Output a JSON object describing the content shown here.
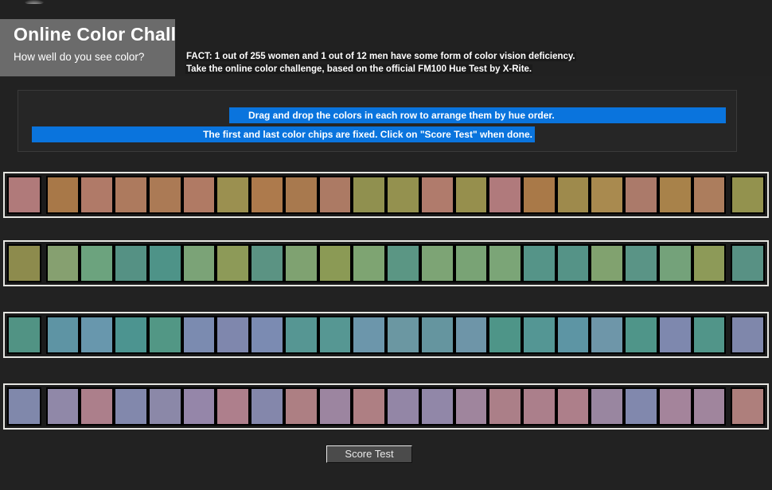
{
  "page": {
    "background": "#222222"
  },
  "header": {
    "title": "Online Color Challenge",
    "subtitle": "How well do you see color?",
    "fact_line_1": "FACT: 1 out of 255 women and 1 out of 12 men have some form of color vision deficiency.",
    "fact_line_2": "Take the online color challenge, based on the official FM100 Hue Test by X-Rite.",
    "left_bg": "#6b6b6b",
    "right_bg": "#212121"
  },
  "instructions": {
    "line_1": "Drag and drop the colors in each row to arrange them by hue order.",
    "line_2": "The first and last color chips are fixed. Click on \"Score Test\" when done.",
    "highlight_color": "#0a74dd"
  },
  "footer": {
    "score_button_label": "Score Test"
  },
  "rows": [
    {
      "index": 1,
      "fixed_first": "#b07a7a",
      "fixed_last": "#93924e",
      "chips": [
        "#a87848",
        "#b07a68",
        "#ad7a5e",
        "#ab7a55",
        "#b07a64",
        "#9b9050",
        "#ad7a4c",
        "#a8794e",
        "#ac7a64",
        "#90904f",
        "#94914f",
        "#b07b6c",
        "#968f4d",
        "#b07a7c",
        "#a97948",
        "#9e8a4c",
        "#a98a4f",
        "#ab7a6a",
        "#a8824a",
        "#ac7d5d"
      ]
    },
    {
      "index": 2,
      "fixed_first": "#8d8b4d",
      "fixed_last": "#589184",
      "chips": [
        "#86a070",
        "#6ca37e",
        "#559184",
        "#4e9388",
        "#7ba377",
        "#8d9a58",
        "#5b9383",
        "#7fa271",
        "#8b9a55",
        "#7ea472",
        "#5b9684",
        "#7da475",
        "#79a375",
        "#7ba577",
        "#559488",
        "#559387",
        "#81a26f",
        "#5a9486",
        "#74a27a",
        "#8d9a58"
      ]
    },
    {
      "index": 3,
      "fixed_first": "#519384",
      "fixed_last": "#7f87ab",
      "chips": [
        "#5e94a4",
        "#6897ad",
        "#4c9490",
        "#529785",
        "#7b8bb0",
        "#7f87ad",
        "#7b8bb2",
        "#569693",
        "#569793",
        "#6c96ab",
        "#6b97a2",
        "#65959f",
        "#6e95a8",
        "#4e9588",
        "#549694",
        "#5d95a4",
        "#6e96a9",
        "#4f9589",
        "#7e88ae",
        "#519589"
      ]
    },
    {
      "index": 4,
      "fixed_first": "#8088ab",
      "fixed_last": "#ae7f7c",
      "chips": [
        "#9088a8",
        "#ac7f8b",
        "#8288ac",
        "#8b88a8",
        "#9586a9",
        "#ae7f8c",
        "#8487ab",
        "#ad7f83",
        "#9c85a0",
        "#ae7f83",
        "#9386a6",
        "#9187a8",
        "#9f859d",
        "#ab7f88",
        "#ab7f8b",
        "#ad7f8a",
        "#9986a0",
        "#8188ad",
        "#a4849b",
        "#a0859d"
      ]
    }
  ]
}
